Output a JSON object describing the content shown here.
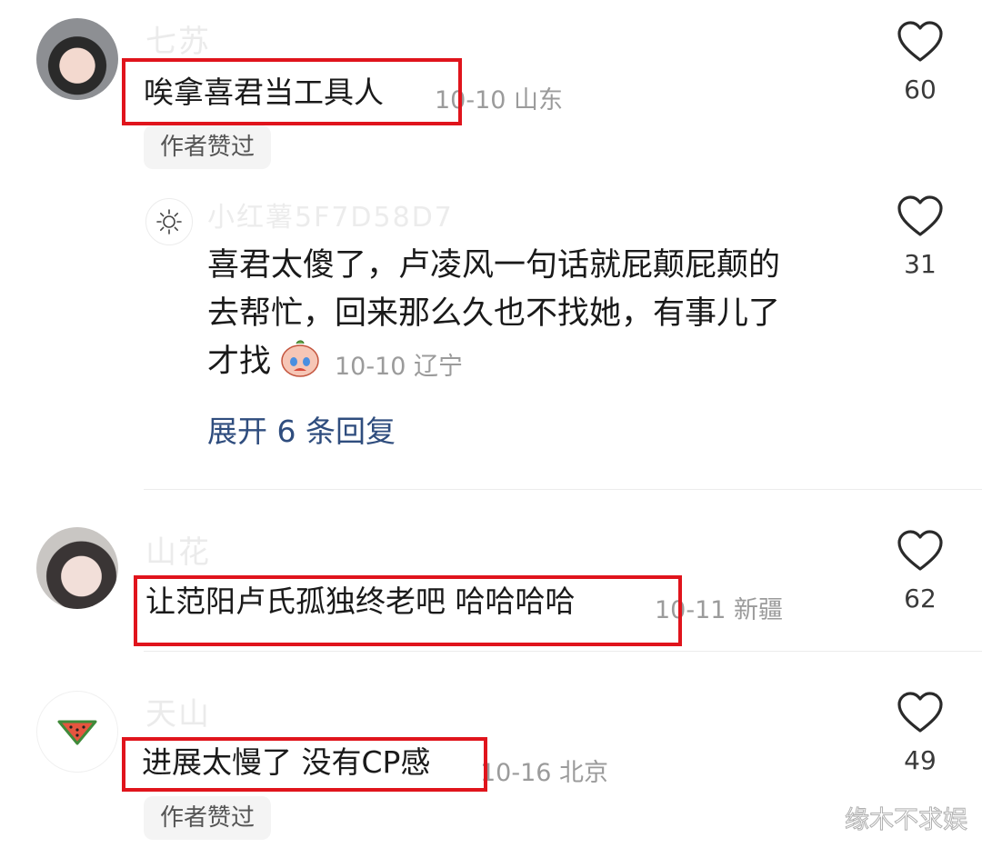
{
  "comments": [
    {
      "username": "七苏",
      "text": "唉拿喜君当工具人",
      "date_location": "10-10 山东",
      "badge": "作者赞过",
      "likes": "60"
    },
    {
      "username": "山花",
      "text": "让范阳卢氏孤独终老吧 哈哈哈哈",
      "date_location": "10-11 新疆",
      "likes": "62"
    },
    {
      "username": "天山",
      "text": "进展太慢了 没有CP感",
      "date_location": "10-16 北京",
      "badge": "作者赞过",
      "likes": "49"
    }
  ],
  "reply": {
    "username": "小红薯5F7D58D7",
    "lines": [
      "喜君太傻了，卢凌风一句话就屁颠屁颠的",
      "去帮忙，回来那么久也不找她，有事儿了",
      "才找"
    ],
    "emoji": "crying-face-emoji",
    "date_location": "10-10 辽宁",
    "likes": "31"
  },
  "expand_replies": "展开 6 条回复",
  "watermark": "缘木不求娱",
  "colors": {
    "highlight": "#e0141c",
    "link": "#2f4d7e",
    "meta": "#9b9b9b"
  }
}
